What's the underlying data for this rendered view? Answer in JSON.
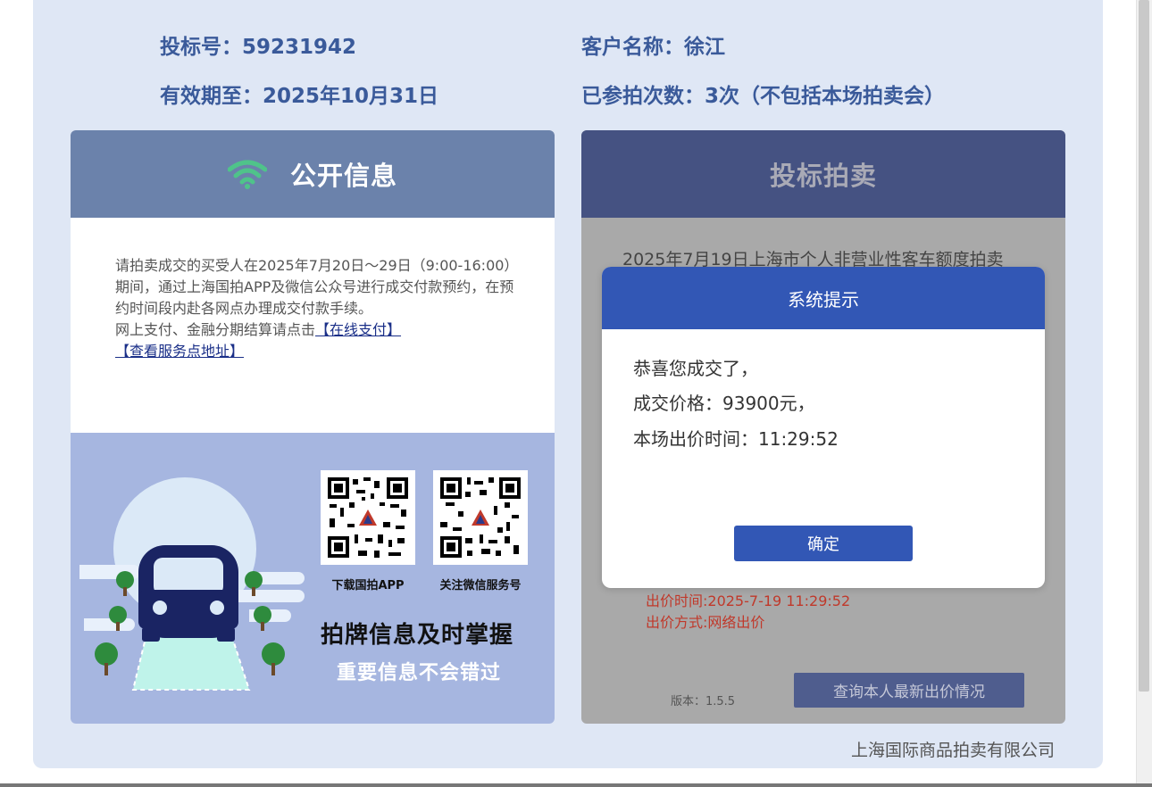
{
  "bidder": {
    "bid_number": "投标号：59231942",
    "customer_name": "客户名称：徐江",
    "valid_until": "有效期至：2025年10月31日",
    "participation_count": "已参拍次数：3次（不包括本场拍卖会）"
  },
  "public_info": {
    "title": "公开信息",
    "notice_text": "请拍卖成交的买受人在2025年7月20日～29日（9:00-16:00）期间，通过上海国拍APP及微信公众号进行成交付款预约，在预约时间段内赴各网点办理成交付款手续。",
    "payment_prefix": "网上支付、金融分期结算请点击",
    "online_payment_link": "【在线支付】",
    "service_address_link": "【查看服务点地址】",
    "qr_app_label": "下载国拍APP",
    "qr_wechat_label": "关注微信服务号",
    "promo_line1": "拍牌信息及时掌握",
    "promo_line2": "重要信息不会错过"
  },
  "auction": {
    "title": "投标拍卖",
    "auction_name": "2025年7月19日上海市个人非营业性客车额度拍卖",
    "bid_time": "出价时间:2025-7-19 11:29:52",
    "bid_method": "出价方式:网络出价",
    "version": "版本：1.5.5",
    "query_button": "查询本人最新出价情况"
  },
  "modal": {
    "title": "系统提示",
    "line1": "恭喜您成交了，",
    "line2": "成交价格：93900元，",
    "line3": "本场出价时间：11:29:52",
    "confirm_button": "确定"
  },
  "footer": {
    "company": "上海国际商品拍卖有限公司"
  },
  "colors": {
    "panel_bg": "#dfe7f5",
    "info_text": "#3a5a9a",
    "public_header": "#6b82ab",
    "auction_header": "#455282",
    "modal_accent": "#3257b5",
    "wifi_green": "#4fc38a",
    "bid_red": "#c0392b"
  },
  "icons": [
    "wifi-icon",
    "qr-code-app",
    "qr-code-wechat",
    "car-illustration"
  ]
}
